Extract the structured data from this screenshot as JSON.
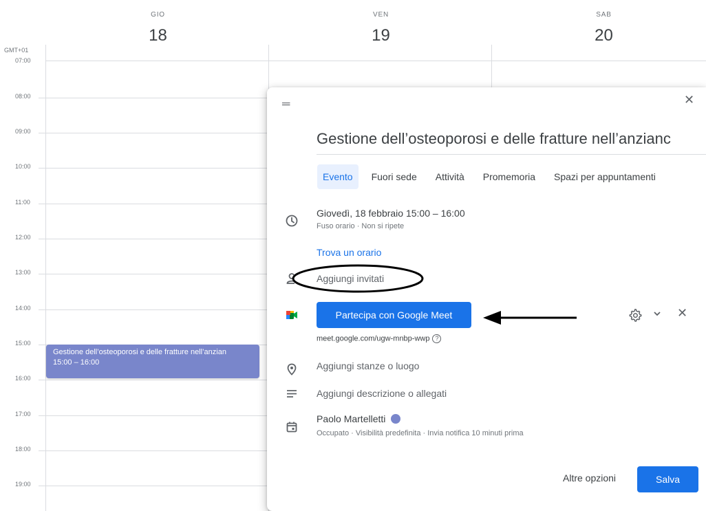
{
  "calendar": {
    "timezone": "GMT+01",
    "days": [
      {
        "dow": "GIO",
        "num": "18"
      },
      {
        "dow": "VEN",
        "num": "19"
      },
      {
        "dow": "SAB",
        "num": "20"
      }
    ],
    "hours": [
      "07:00",
      "08:00",
      "09:00",
      "10:00",
      "11:00",
      "12:00",
      "13:00",
      "14:00",
      "15:00",
      "16:00",
      "17:00",
      "18:00",
      "19:00"
    ],
    "event": {
      "title": "Gestione dell’osteoporosi e delle fratture nell’anzian",
      "time": "15:00 – 16:00",
      "color": "#7986cb"
    }
  },
  "dialog": {
    "drag_icon": "drag-handle-icon",
    "title": "Gestione dell’osteoporosi e delle fratture nell’anzianc",
    "tabs": [
      "Evento",
      "Fuori sede",
      "Attività",
      "Promemoria",
      "Spazi per appuntamenti"
    ],
    "active_tab": "Evento",
    "date_line": "Giovedì, 18 febbraio   15:00  –  16:00",
    "date_sub": "Fuso orario · Non si ripete",
    "find_time": "Trova un orario",
    "add_guests": "Aggiungi invitati",
    "meet_button": "Partecipa con Google Meet",
    "meet_link": "meet.google.com/ugw-mnbp-wwp",
    "help_glyph": "?",
    "add_location": "Aggiungi stanze o luogo",
    "add_description": "Aggiungi descrizione o allegati",
    "owner_name": "Paolo Martelletti",
    "owner_sub": "Occupato · Visibilità predefinita · Invia notifica 10 minuti prima",
    "more_options": "Altre opzioni",
    "save": "Salva",
    "accent_color": "#1a73e8"
  }
}
